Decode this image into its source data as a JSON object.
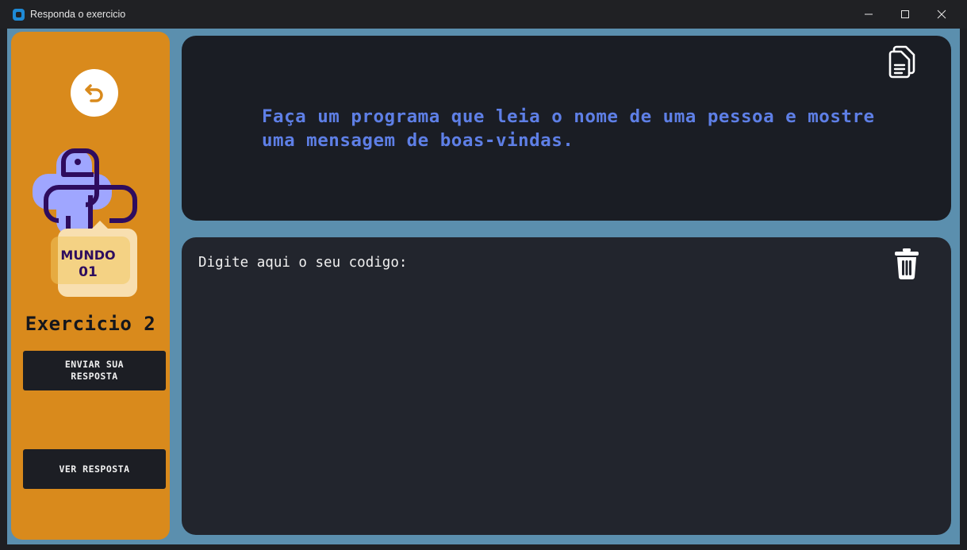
{
  "window": {
    "title": "Responda o exercicio",
    "icons": {
      "minimize": "minimize-icon",
      "maximize": "maximize-icon",
      "close": "close-icon"
    }
  },
  "sidebar": {
    "back_icon": "undo-arrow-icon",
    "badge": {
      "line1": "MUNDO",
      "line2": "01"
    },
    "exercise_title": "Exercicio 2",
    "send_button": "ENVIAR SUA RESPOSTA",
    "see_answer_button": "VER RESPOSTA"
  },
  "question": {
    "text": "Faça um programa que leia o nome de uma pessoa e mostre uma mensagem de boas-vindas.",
    "copy_icon": "copy-document-icon"
  },
  "code": {
    "placeholder": "Digite aqui o seu codigo:",
    "trash_icon": "trash-icon"
  },
  "colors": {
    "sidebar": "#d98a1c",
    "background": "#5b8fae",
    "panel_dark": "#1a1d24",
    "question_text": "#5e7fe6"
  }
}
